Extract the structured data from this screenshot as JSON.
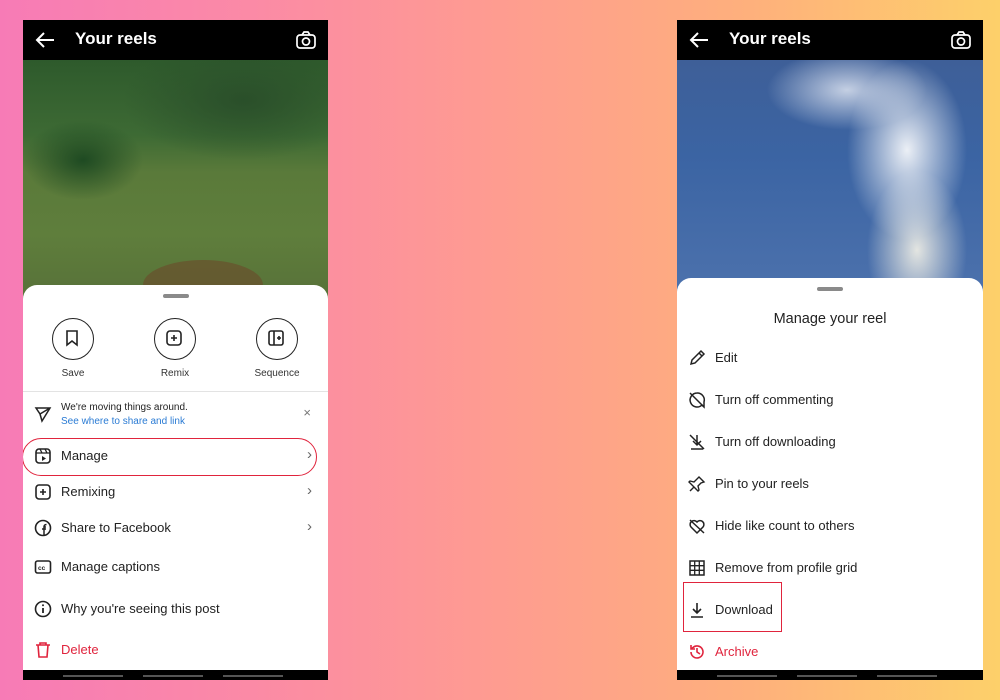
{
  "left_screen": {
    "title": "Your reels",
    "quick_actions": [
      {
        "label": "Save",
        "icon": "bookmark-icon"
      },
      {
        "label": "Remix",
        "icon": "remix-icon"
      },
      {
        "label": "Sequence",
        "icon": "sequence-icon"
      }
    ],
    "notice": {
      "line1": "We're moving things around.",
      "link": "See where to share and link"
    },
    "menu": [
      {
        "label": "Manage",
        "icon": "reel-icon",
        "chevron": true
      },
      {
        "label": "Remixing",
        "icon": "remix-icon",
        "chevron": true
      },
      {
        "label": "Share to Facebook",
        "icon": "facebook-icon",
        "chevron": true
      },
      {
        "label": "Manage captions",
        "icon": "cc-icon",
        "chevron": false
      },
      {
        "label": "Why you're seeing this post",
        "icon": "info-icon",
        "chevron": false
      },
      {
        "label": "Delete",
        "icon": "trash-icon",
        "chevron": false,
        "destructive": true
      }
    ]
  },
  "right_screen": {
    "title": "Your reels",
    "sheet_title": "Manage your reel",
    "menu": [
      {
        "label": "Edit",
        "icon": "pencil-icon"
      },
      {
        "label": "Turn off commenting",
        "icon": "comment-off-icon"
      },
      {
        "label": "Turn off downloading",
        "icon": "download-off-icon"
      },
      {
        "label": "Pin to your reels",
        "icon": "pin-icon"
      },
      {
        "label": "Hide like count to others",
        "icon": "heart-off-icon"
      },
      {
        "label": "Remove from profile grid",
        "icon": "grid-icon"
      },
      {
        "label": "Download",
        "icon": "download-icon"
      },
      {
        "label": "Archive",
        "icon": "archive-icon",
        "destructive": true
      }
    ]
  },
  "colors": {
    "accent_red": "#e0243d",
    "link_blue": "#2a7bd4",
    "background_gradient": [
      "#f77bb6",
      "#fdd06a"
    ]
  }
}
